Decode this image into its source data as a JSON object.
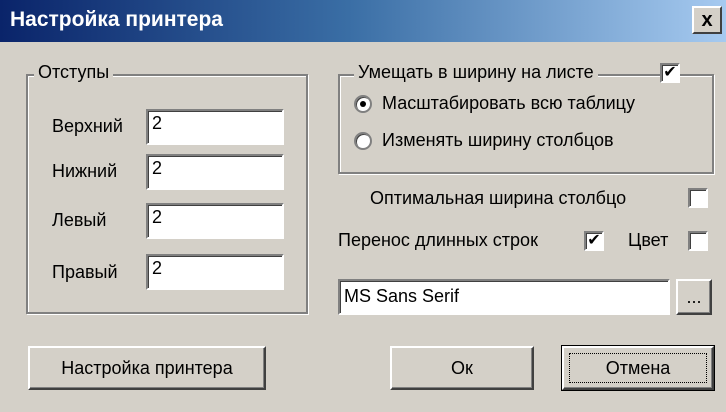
{
  "window": {
    "title": "Настройка принтера",
    "close_label": "x"
  },
  "margins": {
    "legend": "Отступы",
    "top_label": "Верхний",
    "top_value": "2",
    "bottom_label": "Нижний",
    "bottom_value": "2",
    "left_label": "Левый",
    "left_value": "2",
    "right_label": "Правый",
    "right_value": "2"
  },
  "fit_width": {
    "legend": "Умещать в ширину на листе",
    "checked": true,
    "options": [
      {
        "label": "Масштабировать всю таблицу",
        "selected": true
      },
      {
        "label": "Изменять ширину столбцов",
        "selected": false
      }
    ]
  },
  "options": {
    "optimal_width_label": "Оптимальная ширина столбцо",
    "optimal_width_checked": false,
    "wrap_label": "Перенос длинных строк",
    "wrap_checked": true,
    "color_label": "Цвет",
    "color_checked": false
  },
  "font": {
    "value": "MS Sans Serif",
    "browse_label": "..."
  },
  "buttons": {
    "printer_setup": "Настройка принтера",
    "ok": "Ок",
    "cancel": "Отмена"
  },
  "glyphs": {
    "check": "✔"
  }
}
